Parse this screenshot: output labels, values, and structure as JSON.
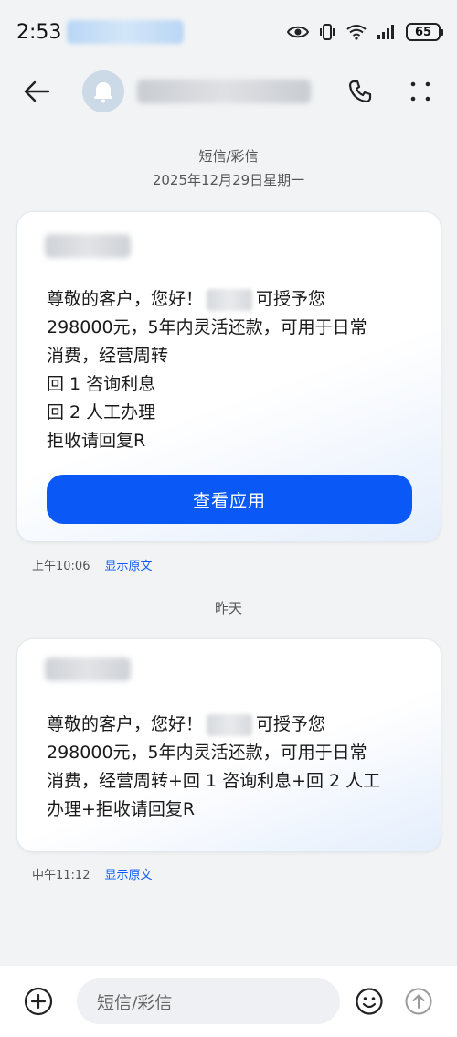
{
  "status_bar": {
    "time": "2:53",
    "battery": "65"
  },
  "header": {
    "back_icon": "arrow-left-icon",
    "avatar_icon": "bell-icon",
    "call_icon": "phone-icon",
    "more_icon": "more-vertical-icon"
  },
  "conversation": {
    "type_label": "短信/彩信",
    "date_label": "2025年12月29日星期一",
    "yesterday_label": "昨天"
  },
  "messages": [
    {
      "lines": [
        [
          "尊敬的客户，您好！",
          "可授予您"
        ],
        [
          "298000元，5年内灵活还款，可用于日常"
        ],
        [
          "消费，经营周转"
        ],
        [
          "回 1 咨询利息"
        ],
        [
          "回 2 人工办理"
        ],
        [
          "拒收请回复R"
        ]
      ],
      "button_label": "查看应用",
      "time": "上午10:06",
      "show_original": "显示原文"
    },
    {
      "lines": [
        [
          "尊敬的客户，您好！",
          "可授予您"
        ],
        [
          "298000元，5年内灵活还款，可用于日常"
        ],
        [
          "消费，经营周转+回 1 咨询利息+回 2 人工"
        ],
        [
          "办理+拒收请回复R"
        ]
      ],
      "time": "中午11:12",
      "show_original": "显示原文"
    }
  ],
  "composer": {
    "placeholder": "短信/彩信",
    "add_icon": "plus-circle-icon",
    "emoji_icon": "smiley-icon",
    "send_icon": "send-arrow-up-icon"
  }
}
